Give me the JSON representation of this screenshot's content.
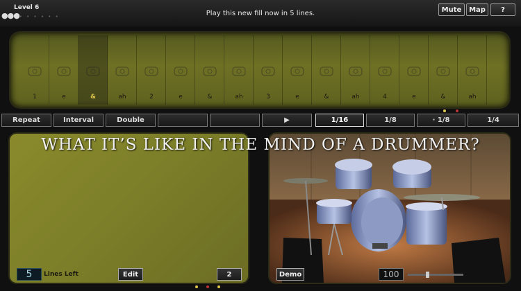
{
  "header": {
    "level": "Level 6",
    "message": "Play this new fill now in 5 lines.",
    "mute": "Mute",
    "map": "Map",
    "help": "?"
  },
  "sequencer": {
    "beats": [
      "1",
      "e",
      "&",
      "ah",
      "2",
      "e",
      "&",
      "ah",
      "3",
      "e",
      "&",
      "ah",
      "4",
      "e",
      "&",
      "ah"
    ],
    "active_index": 2,
    "pad_icons": [
      "tom-icon",
      "snare-pad-icon",
      "hihat-icon",
      "tom-icon",
      "bar-icon",
      "bar-icon",
      "pedal-icon",
      "bar-icon",
      "pedal-icon",
      "bar-icon",
      "bar-icon",
      "bar-icon",
      "bar-icon",
      "bar-icon",
      "hihat-icon",
      "tom-icon"
    ]
  },
  "buttons": {
    "repeat": "Repeat",
    "interval": "Interval",
    "double": "Double",
    "play": "▶",
    "sixteenth": "1/16",
    "eighth": "1/8",
    "dotted_eighth": "· 1/8",
    "quarter": "1/4"
  },
  "left_panel": {
    "lines_left_value": "5",
    "lines_left_label": "Lines Left",
    "edit": "Edit",
    "count": "2"
  },
  "right_panel": {
    "demo": "Demo",
    "tempo": "100",
    "tempo_fraction": 0.35
  },
  "caption": "WHAT IT’S LIKE IN THE MIND OF A DRUMMER?",
  "colors": {
    "panel_green": "#7d7f29",
    "highlight": "#e0c84a"
  }
}
